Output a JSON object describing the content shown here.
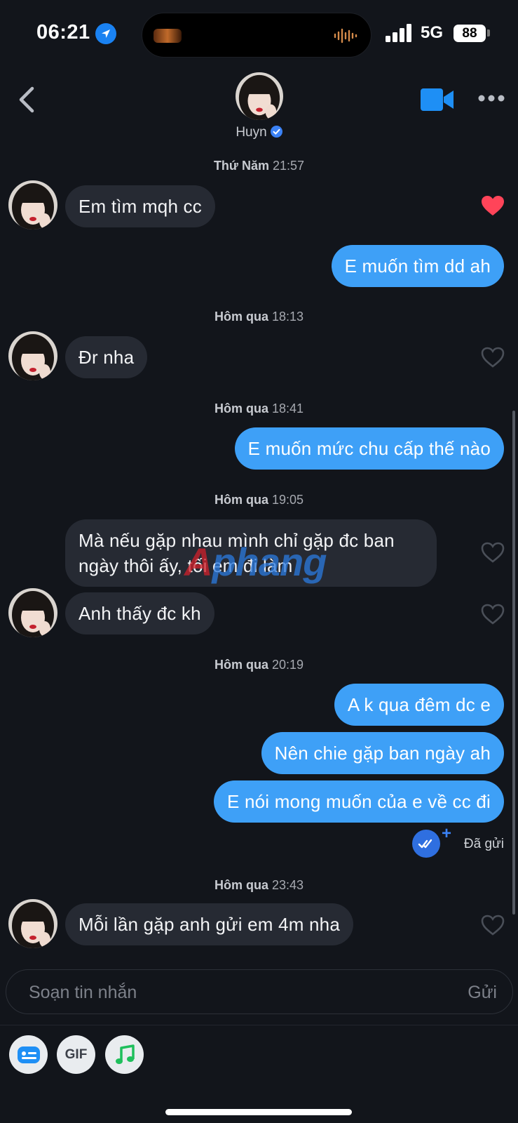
{
  "status_bar": {
    "time": "06:21",
    "network": "5G",
    "battery": "88"
  },
  "header": {
    "contact_name": "Huyn",
    "back_label": "back",
    "video_icon": "video-camera-icon",
    "more_icon": "more-dots-icon"
  },
  "messages": [
    {
      "type": "timestamp",
      "day": "Thứ Năm",
      "time": "21:57"
    },
    {
      "type": "received",
      "text": "Em tìm mqh cc",
      "liked": true
    },
    {
      "type": "sent",
      "text": "E muốn tìm dd ah"
    },
    {
      "type": "timestamp",
      "day": "Hôm qua",
      "time": "18:13"
    },
    {
      "type": "received",
      "text": "Đr nha",
      "liked": false
    },
    {
      "type": "timestamp",
      "day": "Hôm qua",
      "time": "18:41"
    },
    {
      "type": "sent",
      "text": "E muốn mức chu cấp thế nào"
    },
    {
      "type": "timestamp",
      "day": "Hôm qua",
      "time": "19:05"
    },
    {
      "type": "received",
      "text": "Mà nếu gặp nhau mình chỉ gặp đc ban ngày thôi ấy, tối em đi làm",
      "liked": false
    },
    {
      "type": "received",
      "text": "Anh thấy đc kh",
      "liked": false
    },
    {
      "type": "timestamp",
      "day": "Hôm qua",
      "time": "20:19"
    },
    {
      "type": "sent",
      "text": "A k qua đêm dc e"
    },
    {
      "type": "sent",
      "text": "Nên chie gặp ban ngày ah"
    },
    {
      "type": "sent",
      "text": "E nói mong muốn của e về cc đi"
    },
    {
      "type": "timestamp",
      "day": "Hôm qua",
      "time": "23:43"
    },
    {
      "type": "received",
      "text": "Mỗi lần gặp anh gửi em 4m nha",
      "liked": false
    }
  ],
  "sent_status": "Đã gửi",
  "watermark": {
    "part_red": "A",
    "part_blue": "phang"
  },
  "composer": {
    "placeholder": "Soạn tin nhắn",
    "send_label": "Gửi"
  },
  "toolbar": {
    "gif_label": "GIF",
    "tools": [
      "sticker-icon",
      "gif-icon",
      "music-note-icon"
    ]
  },
  "colors": {
    "background": "#12151b",
    "sent_bubble": "#3ea0f7",
    "received_bubble": "#262a33",
    "like_heart": "#ff4459",
    "accent": "#1a82f2"
  }
}
